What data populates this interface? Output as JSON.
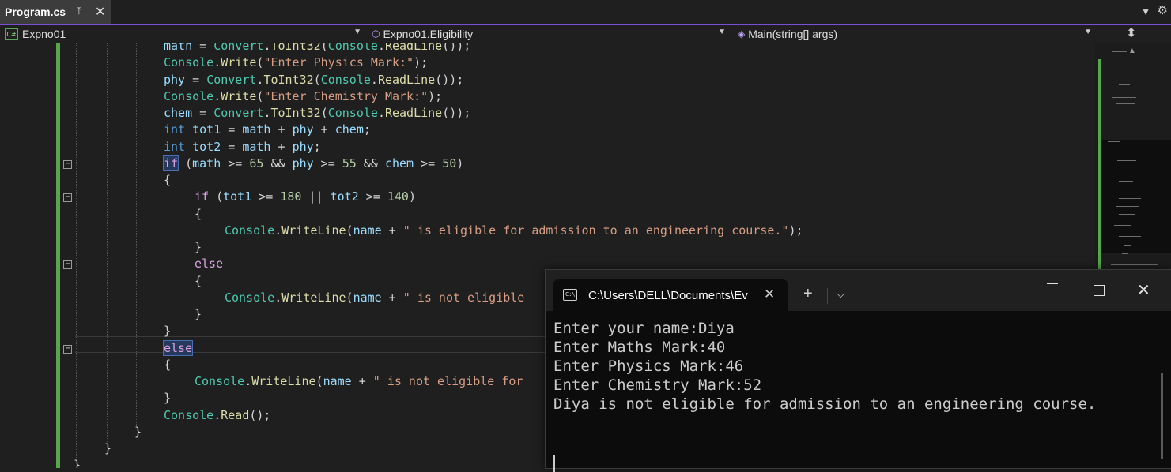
{
  "tab": {
    "title": "Program.cs",
    "pin_icon": "pin-icon",
    "close_icon": "close-icon"
  },
  "navbar": {
    "project": "Expno01",
    "class": "Expno01.Eligibility",
    "member": "Main(string[] args)",
    "cs_badge": "C#"
  },
  "code_lines": [
    [
      [
        "var",
        "math"
      ],
      [
        "pun",
        " = "
      ],
      [
        "typ",
        "Convert"
      ],
      [
        "pun",
        "."
      ],
      [
        "mth",
        "ToInt32"
      ],
      [
        "pun",
        "("
      ],
      [
        "typ",
        "Console"
      ],
      [
        "pun",
        "."
      ],
      [
        "mth",
        "ReadLine"
      ],
      [
        "pun",
        "());"
      ]
    ],
    [
      [
        "typ",
        "Console"
      ],
      [
        "pun",
        "."
      ],
      [
        "mth",
        "Write"
      ],
      [
        "pun",
        "("
      ],
      [
        "str",
        "\"Enter Physics Mark:\""
      ],
      [
        "pun",
        ");"
      ]
    ],
    [
      [
        "var",
        "phy"
      ],
      [
        "pun",
        " = "
      ],
      [
        "typ",
        "Convert"
      ],
      [
        "pun",
        "."
      ],
      [
        "mth",
        "ToInt32"
      ],
      [
        "pun",
        "("
      ],
      [
        "typ",
        "Console"
      ],
      [
        "pun",
        "."
      ],
      [
        "mth",
        "ReadLine"
      ],
      [
        "pun",
        "());"
      ]
    ],
    [
      [
        "typ",
        "Console"
      ],
      [
        "pun",
        "."
      ],
      [
        "mth",
        "Write"
      ],
      [
        "pun",
        "("
      ],
      [
        "str",
        "\"Enter Chemistry Mark:\""
      ],
      [
        "pun",
        ");"
      ]
    ],
    [
      [
        "var",
        "chem"
      ],
      [
        "pun",
        " = "
      ],
      [
        "typ",
        "Convert"
      ],
      [
        "pun",
        "."
      ],
      [
        "mth",
        "ToInt32"
      ],
      [
        "pun",
        "("
      ],
      [
        "typ",
        "Console"
      ],
      [
        "pun",
        "."
      ],
      [
        "mth",
        "ReadLine"
      ],
      [
        "pun",
        "());"
      ]
    ],
    [
      [
        "kw",
        "int"
      ],
      [
        "pun",
        " "
      ],
      [
        "var",
        "tot1"
      ],
      [
        "pun",
        " = "
      ],
      [
        "var",
        "math"
      ],
      [
        "pun",
        " + "
      ],
      [
        "var",
        "phy"
      ],
      [
        "pun",
        " + "
      ],
      [
        "var",
        "chem"
      ],
      [
        "pun",
        ";"
      ]
    ],
    [
      [
        "kw",
        "int"
      ],
      [
        "pun",
        " "
      ],
      [
        "var",
        "tot2"
      ],
      [
        "pun",
        " = "
      ],
      [
        "var",
        "math"
      ],
      [
        "pun",
        " + "
      ],
      [
        "var",
        "phy"
      ],
      [
        "pun",
        ";"
      ]
    ],
    [
      [
        "ctl",
        "if"
      ],
      [
        "pun",
        " ("
      ],
      [
        "var",
        "math"
      ],
      [
        "pun",
        " >= "
      ],
      [
        "num",
        "65"
      ],
      [
        "pun",
        " && "
      ],
      [
        "var",
        "phy"
      ],
      [
        "pun",
        " >= "
      ],
      [
        "num",
        "55"
      ],
      [
        "pun",
        " && "
      ],
      [
        "var",
        "chem"
      ],
      [
        "pun",
        " >= "
      ],
      [
        "num",
        "50"
      ],
      [
        "pun",
        ")"
      ]
    ],
    [
      [
        "pun",
        "{"
      ]
    ],
    [
      [
        "ctl",
        "if"
      ],
      [
        "pun",
        " ("
      ],
      [
        "var",
        "tot1"
      ],
      [
        "pun",
        " >= "
      ],
      [
        "num",
        "180"
      ],
      [
        "pun",
        " || "
      ],
      [
        "var",
        "tot2"
      ],
      [
        "pun",
        " >= "
      ],
      [
        "num",
        "140"
      ],
      [
        "pun",
        ")"
      ]
    ],
    [
      [
        "pun",
        "{"
      ]
    ],
    [
      [
        "typ",
        "Console"
      ],
      [
        "pun",
        "."
      ],
      [
        "mth",
        "WriteLine"
      ],
      [
        "pun",
        "("
      ],
      [
        "var",
        "name"
      ],
      [
        "pun",
        " + "
      ],
      [
        "str",
        "\" is eligible for admission to an engineering course.\""
      ],
      [
        "pun",
        ");"
      ]
    ],
    [
      [
        "pun",
        "}"
      ]
    ],
    [
      [
        "ctl",
        "else"
      ]
    ],
    [
      [
        "pun",
        "{"
      ]
    ],
    [
      [
        "typ",
        "Console"
      ],
      [
        "pun",
        "."
      ],
      [
        "mth",
        "WriteLine"
      ],
      [
        "pun",
        "("
      ],
      [
        "var",
        "name"
      ],
      [
        "pun",
        " + "
      ],
      [
        "str",
        "\" is not eligible"
      ]
    ],
    [
      [
        "pun",
        "}"
      ]
    ],
    [
      [
        "pun",
        "}"
      ]
    ],
    [
      [
        "ctl",
        "else"
      ]
    ],
    [
      [
        "pun",
        "{"
      ]
    ],
    [
      [
        "typ",
        "Console"
      ],
      [
        "pun",
        "."
      ],
      [
        "mth",
        "WriteLine"
      ],
      [
        "pun",
        "("
      ],
      [
        "var",
        "name"
      ],
      [
        "pun",
        " + "
      ],
      [
        "str",
        "\" is not eligible for"
      ]
    ],
    [
      [
        "pun",
        "}"
      ]
    ],
    [
      [
        "typ",
        "Console"
      ],
      [
        "pun",
        "."
      ],
      [
        "mth",
        "Read"
      ],
      [
        "pun",
        "();"
      ]
    ],
    [
      [
        "pun",
        "}"
      ]
    ],
    [
      [
        "pun",
        "}"
      ]
    ],
    [
      [
        "pun",
        "}"
      ]
    ]
  ],
  "terminal": {
    "tab_title": "C:\\Users\\DELL\\Documents\\Ev",
    "lines": [
      "Enter your name:Diya",
      "Enter Maths Mark:40",
      "Enter Physics Mark:46",
      "Enter Chemistry Mark:52",
      "Diya is not eligible for admission to an engineering course."
    ]
  },
  "colors": {
    "keyword": "#569cd6",
    "control": "#d8a0df",
    "type": "#4ec9b0",
    "method": "#dcdcaa",
    "string": "#d69d85",
    "number": "#b5cea8",
    "variable": "#9cdcfe",
    "change_bar": "#57a64a"
  }
}
